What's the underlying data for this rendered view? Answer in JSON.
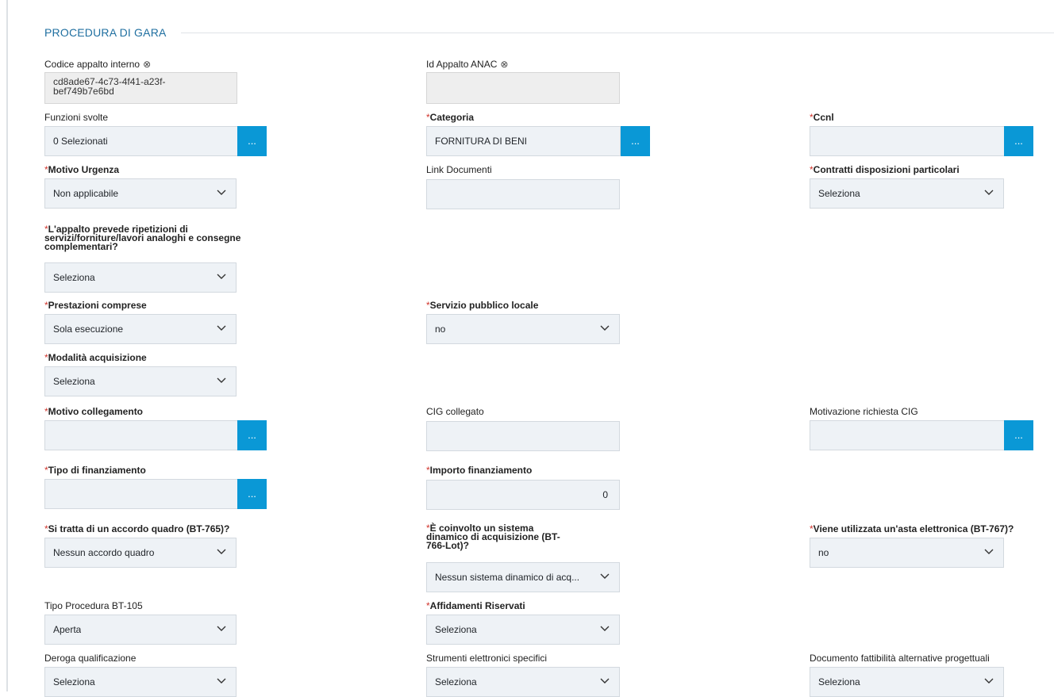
{
  "section": {
    "title": "PROCEDURA DI GARA"
  },
  "fields": {
    "codice_appalto": {
      "label": "Codice appalto interno",
      "clear_icon": "⊗",
      "value": "cd8ade67-4c73-4f41-a23f-bef749b7e6bd"
    },
    "id_appalto_anac": {
      "label": "Id Appalto ANAC",
      "clear_icon": "⊗",
      "value": ""
    },
    "funzioni_svolte": {
      "label": "Funzioni svolte",
      "value": "0 Selezionati",
      "button": "..."
    },
    "categoria": {
      "label": "Categoria",
      "required": "*",
      "value": "FORNITURA DI BENI",
      "button": "..."
    },
    "ccnl": {
      "label": "Ccnl",
      "required": "*",
      "value": "",
      "button": "..."
    },
    "motivo_urgenza": {
      "label": "Motivo Urgenza",
      "required": "*",
      "value": "Non applicabile"
    },
    "link_documenti": {
      "label": "Link Documenti",
      "value": ""
    },
    "contratti_disposizioni": {
      "label": "Contratti disposizioni particolari",
      "required": "*",
      "value": "Seleziona"
    },
    "ripetizioni": {
      "label": "L'appalto prevede ripetizioni di servizi/forniture/lavori analoghi e consegne complementari?",
      "required": "*",
      "value": "Seleziona"
    },
    "prestazioni_comprese": {
      "label": "Prestazioni comprese",
      "required": "*",
      "value": "Sola esecuzione"
    },
    "servizio_pubblico_locale": {
      "label": "Servizio pubblico locale",
      "required": "*",
      "value": "no"
    },
    "modalita_acquisizione": {
      "label": "Modalità acquisizione",
      "required": "*",
      "value": "Seleziona"
    },
    "motivo_collegamento": {
      "label": "Motivo collegamento",
      "required": "*",
      "value": "",
      "button": "..."
    },
    "cig_collegato": {
      "label": "CIG collegato",
      "value": ""
    },
    "motivazione_richiesta_cig": {
      "label": "Motivazione richiesta CIG",
      "value": "",
      "button": "..."
    },
    "tipo_finanziamento": {
      "label": "Tipo di finanziamento",
      "required": "*",
      "value": "",
      "button": "..."
    },
    "importo_finanziamento": {
      "label": "Importo finanziamento",
      "required": "*",
      "value": "0"
    },
    "accordo_quadro": {
      "label": "Si tratta di un accordo quadro (BT-765)?",
      "required": "*",
      "value": "Nessun accordo quadro"
    },
    "sistema_dinamico": {
      "label": "È coinvolto un sistema dinamico di acquisizione (BT-766-Lot)?",
      "required": "*",
      "value": "Nessun sistema dinamico di acq..."
    },
    "asta_elettronica": {
      "label": "Viene utilizzata un'asta elettronica (BT-767)?",
      "required": "*",
      "value": "no"
    },
    "tipo_procedura": {
      "label": "Tipo Procedura BT-105",
      "value": "Aperta"
    },
    "affidamenti_riservati": {
      "label": "Affidamenti Riservati",
      "required": "*",
      "value": "Seleziona"
    },
    "deroga_qualificazione": {
      "label": "Deroga qualificazione",
      "value": "Seleziona"
    },
    "strumenti_elettronici": {
      "label": "Strumenti elettronici specifici",
      "value": "Seleziona"
    },
    "documento_fattibilita": {
      "label": "Documento fattibilità alternative progettuali",
      "value": "Seleziona"
    }
  }
}
